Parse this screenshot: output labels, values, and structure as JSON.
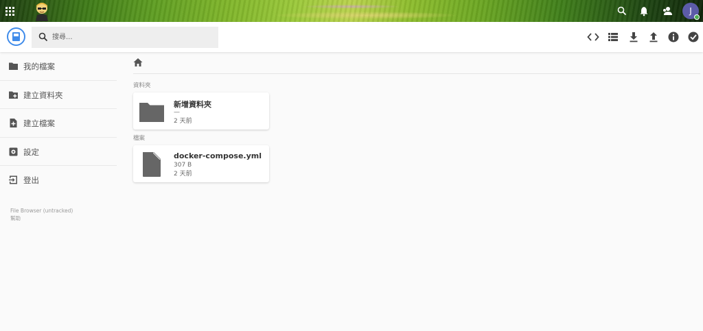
{
  "banner": {
    "avatar_initial": "J"
  },
  "header": {
    "search_placeholder": "搜尋..."
  },
  "sidebar": {
    "items": [
      {
        "label": "我的檔案"
      },
      {
        "label": "建立資料夾"
      },
      {
        "label": "建立檔案"
      },
      {
        "label": "設定"
      },
      {
        "label": "登出"
      }
    ],
    "footer_title": "File Browser (untracked)",
    "footer_help": "幫助"
  },
  "main": {
    "folders_title": "資料夾",
    "files_title": "檔案",
    "folders": [
      {
        "name": "新增資料夾",
        "size": "—",
        "modified": "2 天前"
      }
    ],
    "files": [
      {
        "name": "docker-compose.yml",
        "size": "307 B",
        "modified": "2 天前"
      }
    ]
  },
  "colors": {
    "accent": "#3f8bea",
    "icon_gray": "#666666",
    "background": "#fafafa"
  },
  "icons": {
    "apps": "apps-grid-icon",
    "search": "search-icon",
    "notifications": "bell-icon",
    "contacts": "contacts-icon",
    "toolbar": [
      "code-icon",
      "list-view-icon",
      "download-icon",
      "upload-icon",
      "info-icon",
      "check-circle-icon"
    ]
  }
}
